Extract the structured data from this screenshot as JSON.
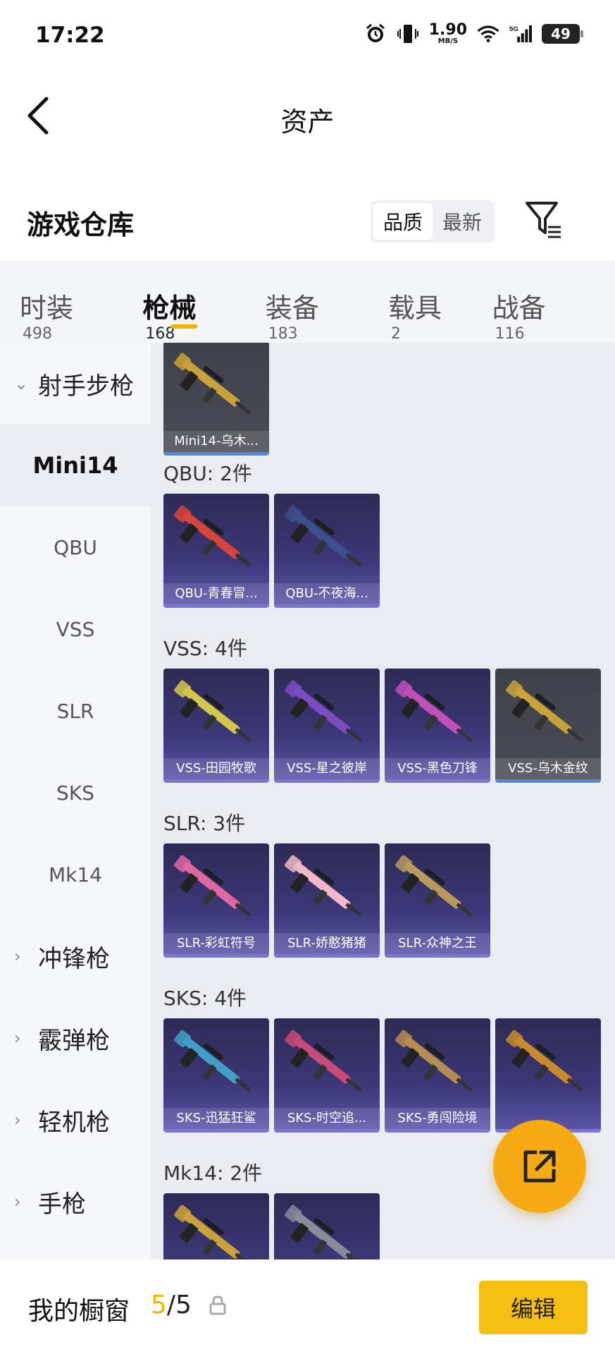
{
  "status_bar": {
    "time": "17:22",
    "speed_value": "1.90",
    "speed_unit": "MB/S",
    "network": "5G",
    "battery": "49"
  },
  "header": {
    "title": "资产"
  },
  "warehouse": {
    "title": "游戏仓库",
    "sort_options": [
      "品质",
      "最新"
    ],
    "active_sort": "品质"
  },
  "tabs": [
    {
      "label": "时装",
      "count": "498"
    },
    {
      "label": "枪械",
      "count": "168",
      "active": true
    },
    {
      "label": "装备",
      "count": "183"
    },
    {
      "label": "载具",
      "count": "2"
    },
    {
      "label": "战备",
      "count": "116"
    }
  ],
  "sidebar": [
    {
      "label": "射手步枪",
      "type": "group",
      "expanded": true
    },
    {
      "label": "Mini14",
      "type": "sub",
      "active": true
    },
    {
      "label": "QBU",
      "type": "sub"
    },
    {
      "label": "VSS",
      "type": "sub"
    },
    {
      "label": "SLR",
      "type": "sub"
    },
    {
      "label": "SKS",
      "type": "sub"
    },
    {
      "label": "Mk14",
      "type": "sub"
    },
    {
      "label": "冲锋枪",
      "type": "group"
    },
    {
      "label": "霰弹枪",
      "type": "group"
    },
    {
      "label": "轻机枪",
      "type": "group"
    },
    {
      "label": "手枪",
      "type": "group"
    }
  ],
  "sections": [
    {
      "title": "",
      "items": [
        {
          "name": "Mini14-乌木...",
          "rarity": "gray",
          "tint": "#c9a23a"
        }
      ]
    },
    {
      "title": "QBU: 2件",
      "items": [
        {
          "name": "QBU-青春冒...",
          "rarity": "purple",
          "tint": "#d9443a"
        },
        {
          "name": "QBU-不夜海...",
          "rarity": "purple",
          "tint": "#3c4f8f"
        }
      ]
    },
    {
      "title": "VSS: 4件",
      "items": [
        {
          "name": "VSS-田园牧歌",
          "rarity": "purple",
          "tint": "#d4c84a"
        },
        {
          "name": "VSS-星之彼岸",
          "rarity": "purple",
          "tint": "#7a4ec0"
        },
        {
          "name": "VSS-黑色刀锋",
          "rarity": "purple",
          "tint": "#c04fb8"
        },
        {
          "name": "VSS-乌木金纹",
          "rarity": "gray",
          "tint": "#c9a23a"
        }
      ]
    },
    {
      "title": "SLR: 3件",
      "items": [
        {
          "name": "SLR-彩虹符号",
          "rarity": "purple",
          "tint": "#e067a0"
        },
        {
          "name": "SLR-娇憨猪猪",
          "rarity": "purple",
          "tint": "#f0b8c8"
        },
        {
          "name": "SLR-众神之王",
          "rarity": "purple",
          "tint": "#b89a5a"
        }
      ]
    },
    {
      "title": "SKS: 4件",
      "items": [
        {
          "name": "SKS-迅猛狂鲨",
          "rarity": "purple",
          "tint": "#3f9fc8"
        },
        {
          "name": "SKS-时空追...",
          "rarity": "purple",
          "tint": "#c84a78"
        },
        {
          "name": "SKS-勇闯险境",
          "rarity": "purple",
          "tint": "#b58c52"
        },
        {
          "name": "",
          "rarity": "purple",
          "tint": "#c88a2a"
        }
      ]
    },
    {
      "title": "Mk14: 2件",
      "items": [
        {
          "name": "",
          "rarity": "purple",
          "tint": "#c9a23a"
        },
        {
          "name": "",
          "rarity": "purple",
          "tint": "#8a8a9a"
        }
      ]
    }
  ],
  "bottom": {
    "label": "我的橱窗",
    "count_current": "5",
    "count_sep": "/",
    "count_total": "5",
    "edit_label": "编辑"
  }
}
